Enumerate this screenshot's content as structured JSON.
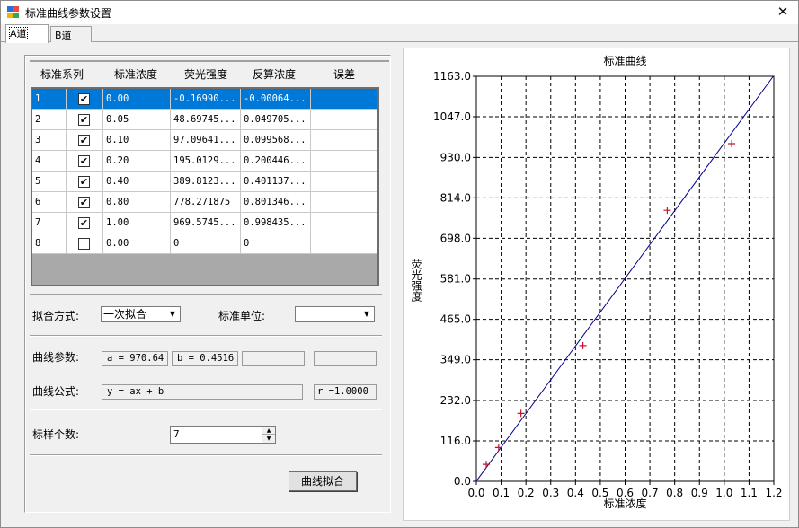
{
  "window": {
    "title": "标准曲线参数设置",
    "close_icon": "close-icon",
    "app_icon": "app-icon"
  },
  "tabs": [
    {
      "label": "A道",
      "active": true
    },
    {
      "label": "B道",
      "active": false
    }
  ],
  "table": {
    "headers": [
      "标准系列",
      "标准浓度",
      "荧光强度",
      "反算浓度",
      "误差"
    ],
    "rows": [
      {
        "no": "1",
        "checked": true,
        "conc": "0.00",
        "fluor": "-0.16990...",
        "calc": "-0.00064...",
        "err": ""
      },
      {
        "no": "2",
        "checked": true,
        "conc": "0.05",
        "fluor": "48.69745...",
        "calc": "0.049705...",
        "err": ""
      },
      {
        "no": "3",
        "checked": true,
        "conc": "0.10",
        "fluor": "97.09641...",
        "calc": "0.099568...",
        "err": ""
      },
      {
        "no": "4",
        "checked": true,
        "conc": "0.20",
        "fluor": "195.0129...",
        "calc": "0.200446...",
        "err": ""
      },
      {
        "no": "5",
        "checked": true,
        "conc": "0.40",
        "fluor": "389.8123...",
        "calc": "0.401137...",
        "err": ""
      },
      {
        "no": "6",
        "checked": true,
        "conc": "0.80",
        "fluor": "778.271875",
        "calc": "0.801346...",
        "err": ""
      },
      {
        "no": "7",
        "checked": true,
        "conc": "1.00",
        "fluor": "969.5745...",
        "calc": "0.998435...",
        "err": ""
      },
      {
        "no": "8",
        "checked": false,
        "conc": "0.00",
        "fluor": "0",
        "calc": "0",
        "err": ""
      }
    ]
  },
  "fit": {
    "method_label": "拟合方式:",
    "method_value": "一次拟合",
    "unit_label": "标准单位:",
    "unit_value": ""
  },
  "params": {
    "label": "曲线参数:",
    "a": "a = 970.64",
    "b": "b = 0.4516",
    "c": "",
    "d": ""
  },
  "formula": {
    "label": "曲线公式:",
    "value": "y = ax + b",
    "r": "r =1.0000"
  },
  "sample_count": {
    "label": "标样个数:",
    "value": "7"
  },
  "fit_button": "曲线拟合",
  "colors": {
    "selection": "#0078d7",
    "line": "#00008b",
    "marker": "#c8102e"
  },
  "chart_data": {
    "type": "scatter",
    "title": "标准曲线",
    "xlabel": "标准浓度",
    "ylabel": "荧光强度",
    "xlim": [
      0,
      1.2
    ],
    "ylim": [
      0,
      1163.0
    ],
    "x_ticks": [
      "0.0",
      "0.1",
      "0.2",
      "0.3",
      "0.4",
      "0.5",
      "0.6",
      "0.7",
      "0.8",
      "0.9",
      "1.0",
      "1.1",
      "1.2"
    ],
    "y_ticks": [
      "0.0",
      "116.0",
      "232.0",
      "349.0",
      "465.0",
      "581.0",
      "698.0",
      "814.0",
      "930.0",
      "1047.0",
      "1163.0"
    ],
    "grid": true,
    "points": [
      {
        "x": 0.04,
        "y": 48.7
      },
      {
        "x": 0.09,
        "y": 97.1
      },
      {
        "x": 0.18,
        "y": 195.0
      },
      {
        "x": 0.43,
        "y": 389.8
      },
      {
        "x": 0.77,
        "y": 778.3
      },
      {
        "x": 1.03,
        "y": 969.6
      }
    ],
    "fit_line": {
      "slope": 970.64,
      "intercept": 0.4516
    }
  }
}
